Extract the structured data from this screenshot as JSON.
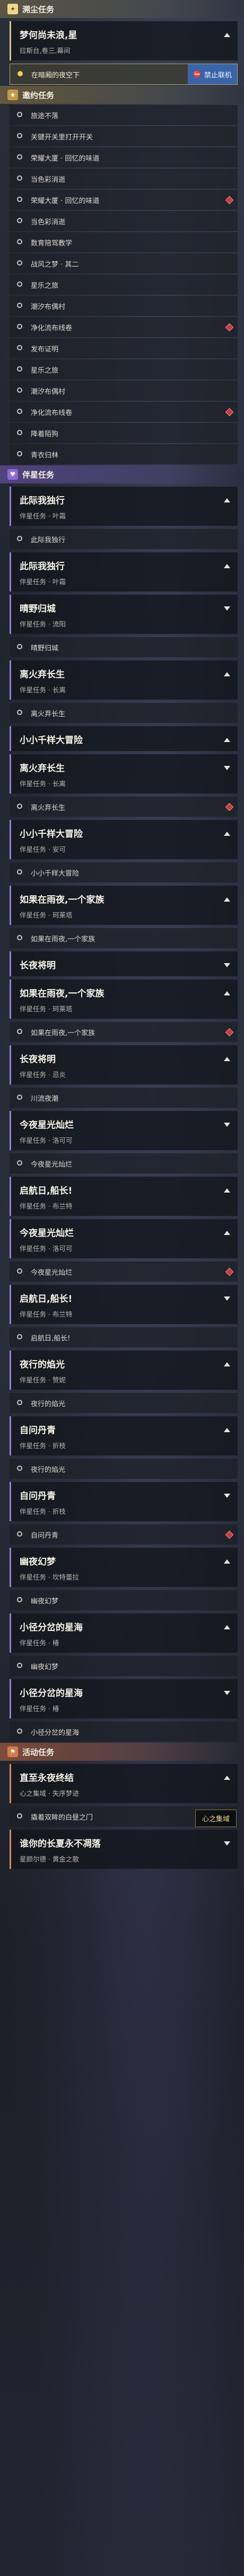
{
  "main": {
    "header": "溯尘任务",
    "title": "梦何尚未浪,星",
    "sub": "拉斯台,卷三,幕间",
    "active_obj": "在暗厢的夜空下",
    "btn_label": "禁止联机"
  },
  "side": {
    "header": "邀约任务",
    "items": [
      "旅途不落",
      "关键开关里打开开关",
      "荣耀大厦 · 回忆的味道",
      "当色彩消逝",
      "荣耀大厦 · 回忆的味道",
      "当色彩消逝",
      "数育陪驾教学",
      "战风之梦 · 其二",
      "星乐之旅",
      "潮汐布偶村",
      "净化流布线卷",
      "发布证明",
      "星乐之旅",
      "潮汐布偶村",
      "净化流布线卷",
      "降着陌狗",
      "青衣归林"
    ]
  },
  "comp": {
    "header": "伴星任务",
    "cards": [
      {
        "title": "此际我独行",
        "sub": "伴星任务 · 叶霜",
        "obj": "此际我独行"
      },
      {
        "title": "此际我独行",
        "sub": "伴星任务 · 叶霜",
        "obj": ""
      },
      {
        "title": "晴野归城",
        "sub": "伴星任务 · 流阳",
        "obj": "晴野归城"
      },
      {
        "title": "离火弃长生",
        "sub": "伴星任务 · 长离",
        "obj": "离火弃长生"
      },
      {
        "title": "小小千样大冒险",
        "sub": "",
        "obj": ""
      },
      {
        "title": "离火弃长生",
        "sub": "伴星任务 · 长离",
        "obj": "离火弃长生"
      },
      {
        "title": "小小千样大冒险",
        "sub": "伴星任务 · 安可",
        "obj": "小小千样大冒险"
      },
      {
        "title": "如果在雨夜,一个家族",
        "sub": "伴星任务 · 珂莱塔",
        "obj": "如果在雨夜,一个家族"
      },
      {
        "title": "长夜将明",
        "sub": "",
        "obj": ""
      },
      {
        "title": "如果在雨夜,一个家族",
        "sub": "伴星任务 · 珂莱塔",
        "obj": "如果在雨夜,一个家族"
      },
      {
        "title": "长夜将明",
        "sub": "伴星任务 · 忌炎",
        "obj": "川流夜潮"
      },
      {
        "title": "今夜星光灿烂",
        "sub": "伴星任务 · 洛可可",
        "obj": "今夜星光灿烂"
      },
      {
        "title": "启航日,船长!",
        "sub": "伴星任务 · 布兰特",
        "obj": ""
      },
      {
        "title": "今夜星光灿烂",
        "sub": "伴星任务 · 洛可可",
        "obj": "今夜星光灿烂"
      },
      {
        "title": "启航日,船长!",
        "sub": "伴星任务 · 布兰特",
        "obj": "启航日,船长!"
      },
      {
        "title": "夜行的焰光",
        "sub": "伴星任务 · 赞妮",
        "obj": "夜行的焰光"
      },
      {
        "title": "自问丹青",
        "sub": "伴星任务 · 折枝",
        "obj": "夜行的焰光"
      },
      {
        "title": "自问丹青",
        "sub": "伴星任务 · 折枝",
        "obj": "自问丹青"
      },
      {
        "title": "幽夜幻梦",
        "sub": "伴星任务 · 坎特蕾拉",
        "obj": "幽夜幻梦"
      },
      {
        "title": "小径分岔的星海",
        "sub": "伴星任务 · 椿",
        "obj": "幽夜幻梦"
      },
      {
        "title": "小径分岔的星海",
        "sub": "伴星任务 · 椿",
        "obj": "小径分岔的星海"
      }
    ]
  },
  "event": {
    "header": "活动任务",
    "title": "直至永夜终结",
    "sub": "心之集域 · 失序梦迹",
    "obj": "撬着双眸的白昼之门",
    "floating": "心之集域",
    "title2": "谁你的长夏永不凋落",
    "sub2": "星颜尔德 · 黄金之歌"
  }
}
